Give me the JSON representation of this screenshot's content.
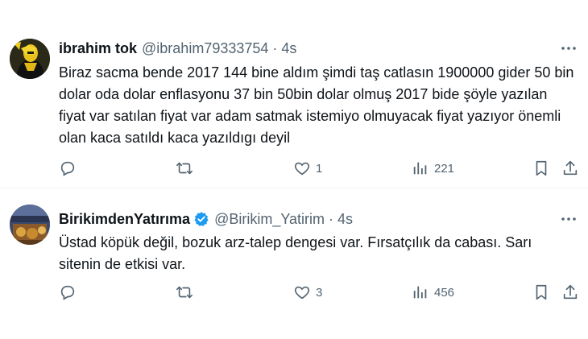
{
  "tweets": [
    {
      "name": "ibrahim tok",
      "handle": "@ibrahim79333754",
      "separator": "·",
      "time": "4s",
      "text": "Biraz sacma bende 2017 144 bine aldım şimdi taş catlasın 1900000 gider 50 bin dolar oda dolar enflasyonu 37 bin 50bin dolar olmuş 2017  bide şöyle yazılan fiyat var satılan fiyat var adam satmak istemiyo olmuyacak fiyat yazıyor önemli olan kaca satıldı kaca yazıldıgı deyil",
      "replies": "",
      "retweets": "",
      "likes": "1",
      "views": "221",
      "verified": false
    },
    {
      "name": "BirikimdenYatırıma",
      "handle": "@Birikim_Yatirim",
      "separator": "·",
      "time": "4s",
      "text": "Üstad köpük değil, bozuk arz-talep dengesi var. Fırsatçılık da cabası. Sarı sitenin de etkisi var.",
      "replies": "",
      "retweets": "",
      "likes": "3",
      "views": "456",
      "verified": true
    }
  ],
  "colors": {
    "text": "#0f1419",
    "secondary": "#536471",
    "verified": "#1d9bf0",
    "divider": "#eff3f4"
  },
  "icons": [
    "reply-icon",
    "retweet-icon",
    "like-icon",
    "views-icon",
    "bookmark-icon",
    "share-icon",
    "more-icon",
    "verified-badge-icon"
  ]
}
